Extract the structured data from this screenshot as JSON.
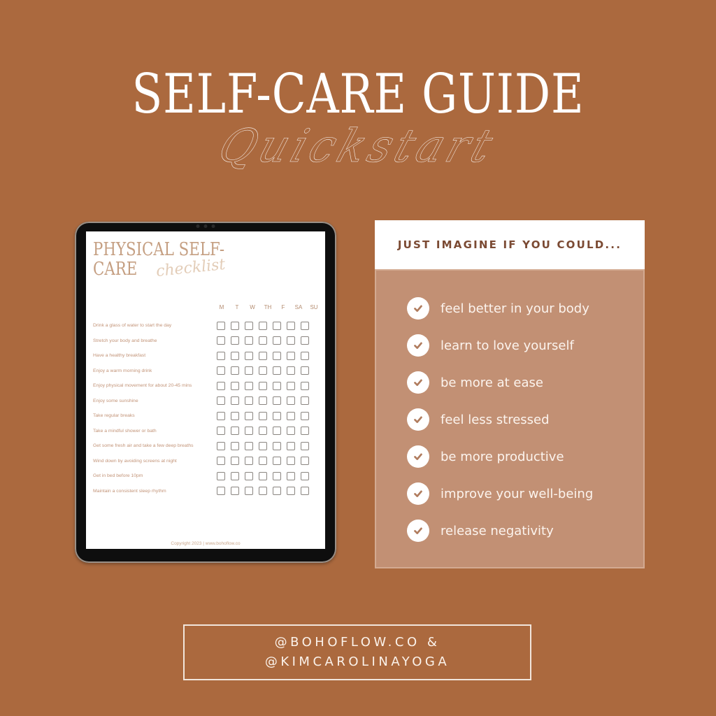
{
  "header": {
    "title": "SELF-CARE GUIDE",
    "subtitle": "Quickstart"
  },
  "tablet": {
    "title_line1": "PHYSICAL SELF-",
    "title_line2": "CARE",
    "script": "checklist",
    "days": [
      "M",
      "T",
      "W",
      "TH",
      "F",
      "SA",
      "SU"
    ],
    "items": [
      "Drink a glass of water to start the day",
      "Stretch your body and breathe",
      "Have a healthy breakfast",
      "Enjoy a warm morning drink",
      "Enjoy physical movement for about 20-45 mins",
      "Enjoy some sunshine",
      "Take regular breaks",
      "Take a mindful shower or bath",
      "Get some fresh air and take a few deep breaths",
      "Wind down by avoiding screens at night",
      "Get in bed before 10pm",
      "Maintain a consistent sleep rhythm"
    ],
    "footer": "Copyright 2023 | www.bohoflow.co"
  },
  "card": {
    "heading": "JUST IMAGINE IF YOU COULD...",
    "items": [
      "feel better in your body",
      "learn to love yourself",
      "be more at ease",
      "feel less stressed",
      "be more productive",
      "improve your well-being",
      "release negativity"
    ],
    "icon": "check-circle-icon"
  },
  "social": {
    "line1": "@BOHOFLOW.CO &",
    "line2": "@KIMCAROLINAYOGA"
  },
  "colors": {
    "background": "#ab693e",
    "card_body": "#c29074",
    "heading_text": "#7b4a33"
  }
}
